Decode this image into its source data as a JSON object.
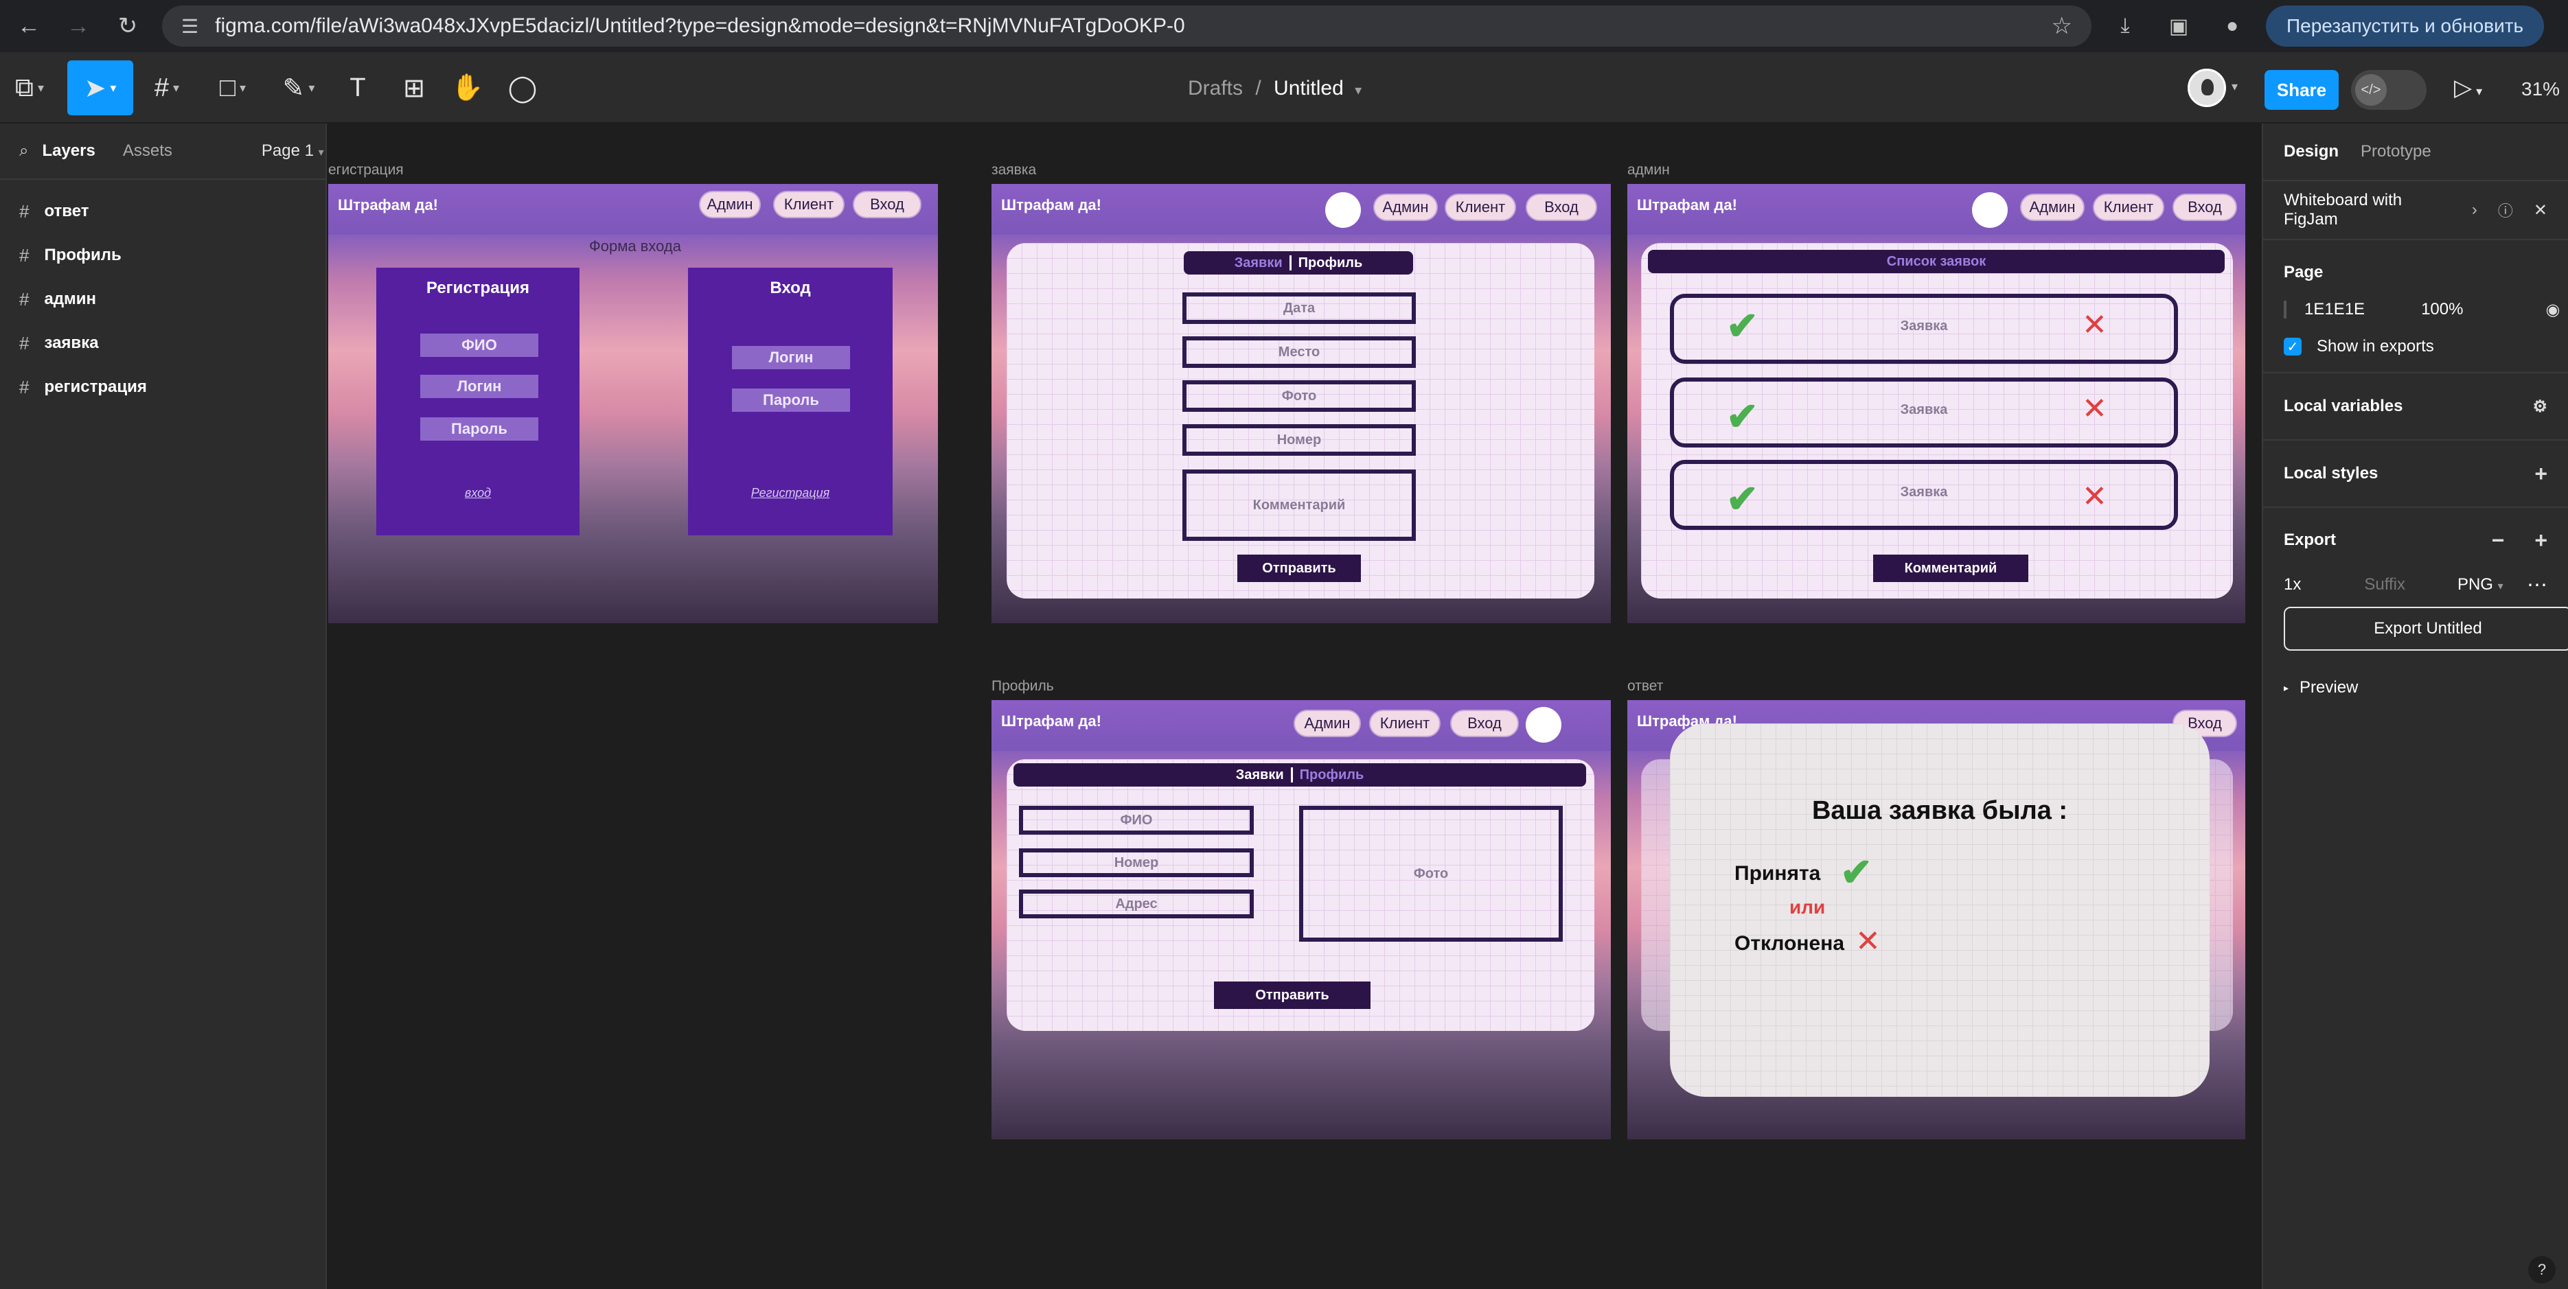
{
  "browser": {
    "url": "figma.com/file/aWi3wa048xJXvpE5dacizl/Untitled?type=design&mode=design&t=RNjMVNuFATgDoOKP-0",
    "relaunch_label": "Перезапустить и обновить"
  },
  "toolbar": {
    "crumb_folder": "Drafts",
    "crumb_sep": "/",
    "file_name": "Untitled",
    "share_label": "Share",
    "zoom": "31%"
  },
  "left_panel": {
    "tabs": [
      "Layers",
      "Assets"
    ],
    "page_label": "Page 1",
    "layers": [
      "ответ",
      "Профиль",
      "админ",
      "заявка",
      "регистрация"
    ]
  },
  "right_panel": {
    "tabs": [
      "Design",
      "Prototype"
    ],
    "whiteboard": "Whiteboard with FigJam",
    "page_heading": "Page",
    "bg_color": "1E1E1E",
    "bg_opacity": "100%",
    "show_in_exports": "Show in exports",
    "local_variables": "Local variables",
    "local_styles": "Local styles",
    "export_heading": "Export",
    "export_scale": "1x",
    "export_suffix_placeholder": "Suffix",
    "export_format": "PNG",
    "export_button": "Export Untitled",
    "preview": "Preview"
  },
  "canvas": {
    "frames": {
      "registration": {
        "label": "егистрация",
        "brand": "Штрафам да!",
        "nav": [
          "Админ",
          "Клиент",
          "Вход"
        ],
        "form_caption": "Форма входа",
        "reg_title": "Регистрация",
        "reg_fields": [
          "ФИО",
          "Логин",
          "Пароль"
        ],
        "reg_link": "вход",
        "login_title": "Вход",
        "login_fields": [
          "Логин",
          "Пароль"
        ],
        "login_link": "Регистрация"
      },
      "request": {
        "label": "заявка",
        "brand": "Штрафам да!",
        "nav": [
          "Админ",
          "Клиент",
          "Вход"
        ],
        "tab_active": "Заявки",
        "tab_other": "Профиль",
        "fields": [
          "Дата",
          "Место",
          "Фото",
          "Номер",
          "Комментарий"
        ],
        "submit": "Отправить"
      },
      "admin": {
        "label": "админ",
        "brand": "Штрафам да!",
        "nav": [
          "Админ",
          "Клиент",
          "Вход"
        ],
        "list_title": "Список заявок",
        "rows": [
          "Заявка",
          "Заявка",
          "Заявка"
        ],
        "check_glyph": "✔",
        "cross_glyph": "✕",
        "comment_btn": "Комментарий"
      },
      "profile": {
        "label": "Профиль",
        "brand": "Штрафам да!",
        "nav": [
          "Админ",
          "Клиент",
          "Вход"
        ],
        "tab_left": "Заявки",
        "tab_right": "Профиль",
        "fields": [
          "ФИО",
          "Номер",
          "Адрес"
        ],
        "photo": "Фото",
        "submit": "Отправить"
      },
      "answer": {
        "label": "ответ",
        "brand": "Штрафам да!",
        "nav_visible": "Вход",
        "heading": "Ваша заявка была :",
        "accepted": "Принята",
        "or": "или",
        "rejected": "Отклонена",
        "check_glyph": "✔",
        "cross_glyph": "✕"
      }
    }
  },
  "colors": {
    "accent": "#0d99ff",
    "dark_purple": "#2d1448",
    "form_purple": "#551fa0",
    "check_green": "#4caf50",
    "cross_red": "#e04040"
  }
}
